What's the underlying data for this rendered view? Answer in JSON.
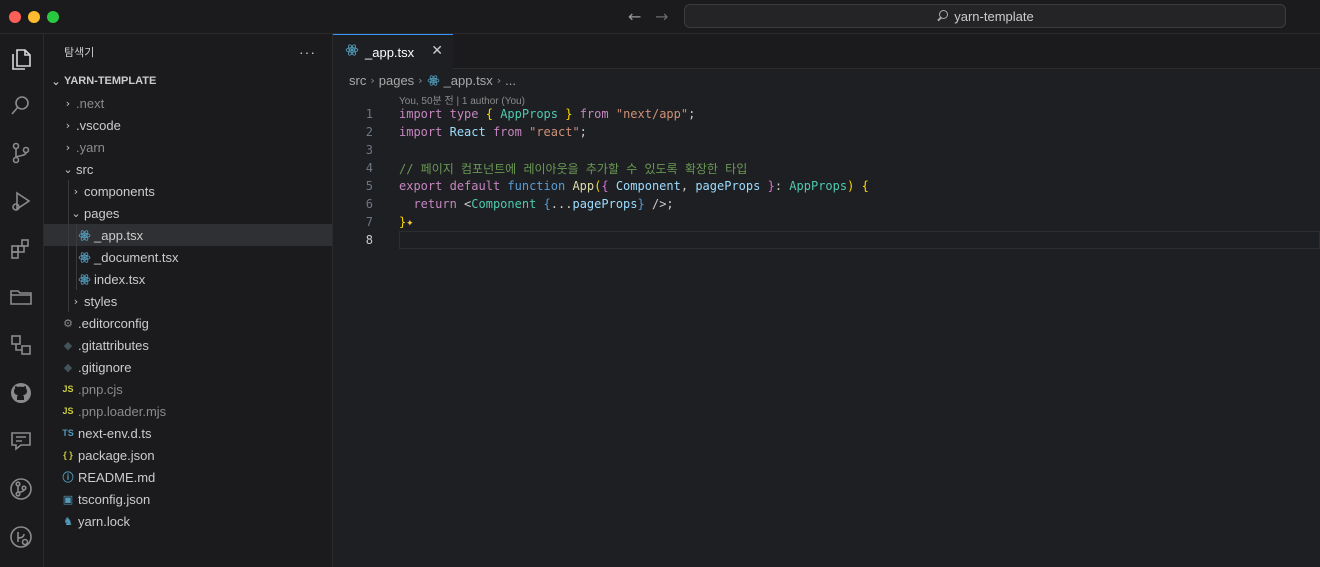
{
  "window": {
    "search_text": "yarn-template"
  },
  "sidebar": {
    "title": "탐색기",
    "more": "···",
    "project": "YARN-TEMPLATE",
    "tree": [
      {
        "label": ".next",
        "kind": "folder",
        "depth": 0,
        "open": false,
        "dim": true
      },
      {
        "label": ".vscode",
        "kind": "folder",
        "depth": 0,
        "open": false,
        "dim": false
      },
      {
        "label": ".yarn",
        "kind": "folder",
        "depth": 0,
        "open": false,
        "dim": true
      },
      {
        "label": "src",
        "kind": "folder",
        "depth": 0,
        "open": true,
        "dim": false
      },
      {
        "label": "components",
        "kind": "folder",
        "depth": 1,
        "open": false,
        "dim": false
      },
      {
        "label": "pages",
        "kind": "folder",
        "depth": 1,
        "open": true,
        "dim": false
      },
      {
        "label": "_app.tsx",
        "kind": "react",
        "depth": 2,
        "selected": true
      },
      {
        "label": "_document.tsx",
        "kind": "react",
        "depth": 2
      },
      {
        "label": "index.tsx",
        "kind": "react",
        "depth": 2
      },
      {
        "label": "styles",
        "kind": "folder",
        "depth": 1,
        "open": false,
        "dim": false
      },
      {
        "label": ".editorconfig",
        "kind": "gear",
        "depth": 0
      },
      {
        "label": ".gitattributes",
        "kind": "git",
        "depth": 0
      },
      {
        "label": ".gitignore",
        "kind": "git",
        "depth": 0
      },
      {
        "label": ".pnp.cjs",
        "kind": "js",
        "depth": 0,
        "dim": true
      },
      {
        "label": ".pnp.loader.mjs",
        "kind": "js",
        "depth": 0,
        "dim": true
      },
      {
        "label": "next-env.d.ts",
        "kind": "ts",
        "depth": 0
      },
      {
        "label": "package.json",
        "kind": "json",
        "depth": 0
      },
      {
        "label": "README.md",
        "kind": "info",
        "depth": 0
      },
      {
        "label": "tsconfig.json",
        "kind": "tsconfig",
        "depth": 0
      },
      {
        "label": "yarn.lock",
        "kind": "yarn",
        "depth": 0
      }
    ]
  },
  "editor": {
    "tab_label": "_app.tsx",
    "tab_close": "✕",
    "breadcrumb": [
      "src",
      "pages",
      "_app.tsx",
      "..."
    ],
    "blame": "You, 50분 전 | 1 author (You)",
    "line_numbers": [
      "1",
      "2",
      "3",
      "4",
      "5",
      "6",
      "7",
      "8"
    ],
    "current_line": "8"
  },
  "icons": {
    "accent": "#3794ff",
    "react_icon_color": "#519aba"
  }
}
